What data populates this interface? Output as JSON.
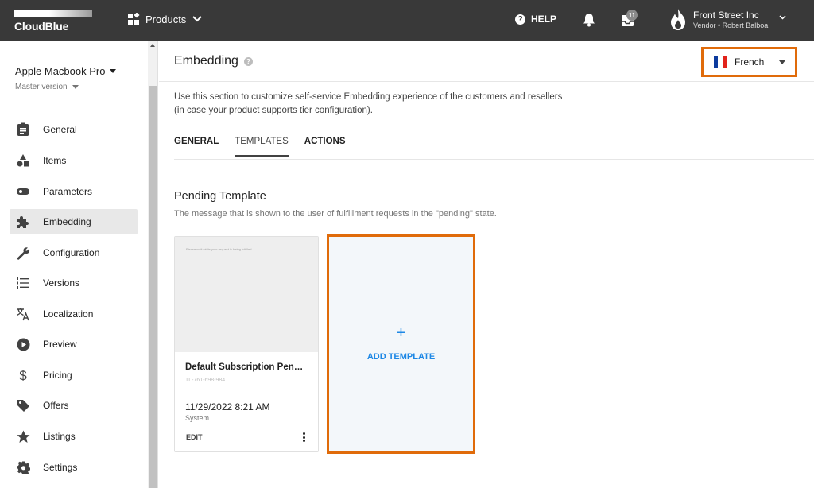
{
  "topbar": {
    "logo_text": "CloudBlue",
    "products_label": "Products",
    "help_label": "HELP",
    "notifications_count": "11",
    "account": {
      "company": "Front Street Inc",
      "role": "Vendor • Robert Balboa"
    }
  },
  "sidebar": {
    "product_name": "Apple Macbook Pro",
    "version_label": "Master version",
    "items": [
      {
        "label": "General",
        "icon": "clipboard-icon"
      },
      {
        "label": "Items",
        "icon": "shapes-icon"
      },
      {
        "label": "Parameters",
        "icon": "toggle-icon"
      },
      {
        "label": "Embedding",
        "icon": "puzzle-icon",
        "active": true
      },
      {
        "label": "Configuration",
        "icon": "wrench-icon"
      },
      {
        "label": "Versions",
        "icon": "list-numbered-icon"
      },
      {
        "label": "Localization",
        "icon": "translate-icon"
      },
      {
        "label": "Preview",
        "icon": "play-circle-icon"
      },
      {
        "label": "Pricing",
        "icon": "dollar-icon"
      },
      {
        "label": "Offers",
        "icon": "tag-icon"
      },
      {
        "label": "Listings",
        "icon": "star-icon"
      },
      {
        "label": "Settings",
        "icon": "gear-icon"
      }
    ]
  },
  "main": {
    "title": "Embedding",
    "language": {
      "selected": "French"
    },
    "description_line1": "Use this section to customize self-service Embedding experience of the customers and resellers",
    "description_line2": "(in case your product supports tier configuration).",
    "tabs": [
      {
        "label": "GENERAL"
      },
      {
        "label": "TEMPLATES",
        "active": true
      },
      {
        "label": "ACTIONS"
      }
    ],
    "section_title": "Pending Template",
    "section_subtitle": "The message that is shown to the user of fulfillment requests in the \"pending\" state.",
    "template_card": {
      "preview_text": "Please wait while your request is being fulfilled.",
      "name": "Default Subscription Pending Template",
      "id": "TL-761-698-984",
      "date": "11/29/2022 8:21 AM",
      "author": "System",
      "edit_label": "EDIT"
    },
    "add_template": {
      "plus": "+",
      "label": "ADD TEMPLATE"
    }
  },
  "colors": {
    "topbar_bg": "#393939",
    "highlight_border": "#e06b0a",
    "accent_blue": "#1e88e5",
    "active_nav_bg": "#e8e8e8",
    "flag": [
      "#0d3b9e",
      "#ffffff",
      "#e1231b"
    ]
  }
}
